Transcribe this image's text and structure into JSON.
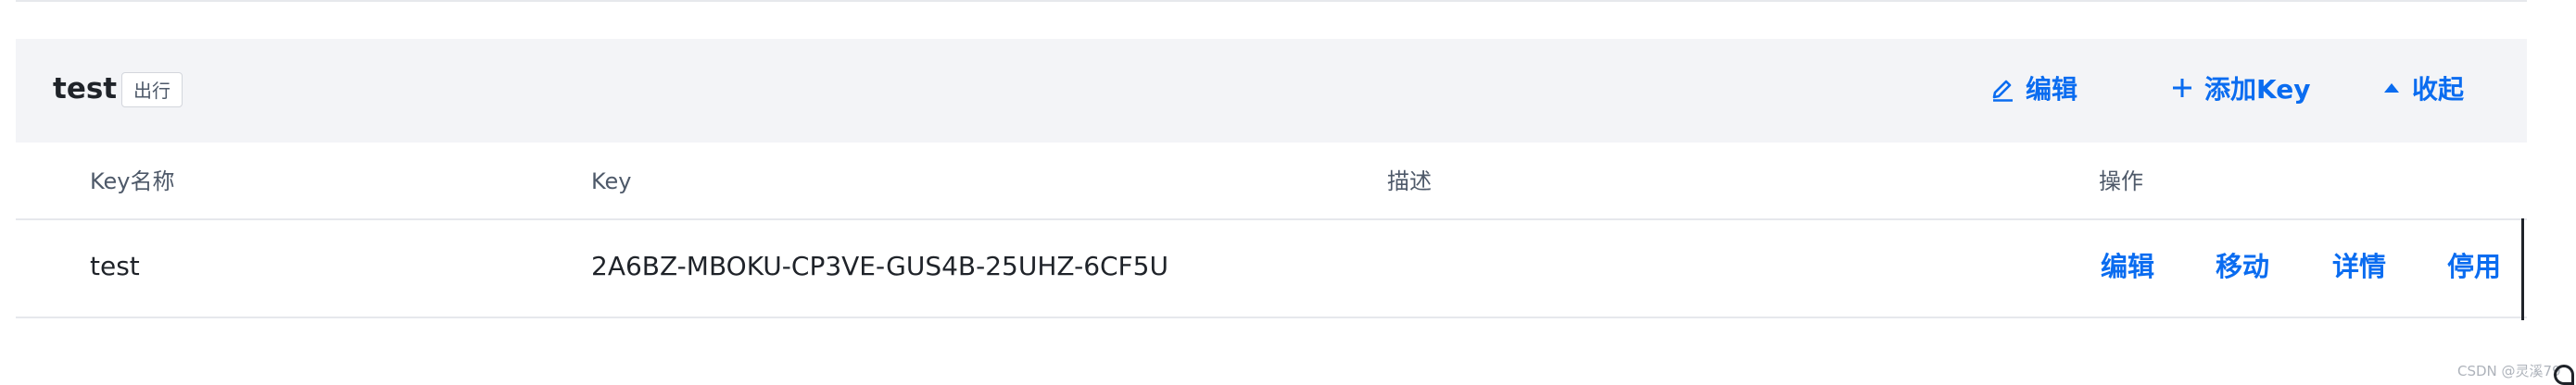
{
  "group": {
    "title": "test",
    "tag": "出行",
    "actions": {
      "edit_label": "编辑",
      "add_key_label": "添加Key",
      "collapse_label": "收起"
    }
  },
  "table": {
    "columns": {
      "key_name": "Key名称",
      "key": "Key",
      "description": "描述",
      "operations": "操作"
    },
    "rows": [
      {
        "key_name": "test",
        "key": "2A6BZ-MBOKU-CP3VE-GUS4B-25UHZ-6CF5U",
        "description": "",
        "ops": {
          "edit": "编辑",
          "move": "移动",
          "detail": "详情",
          "disable": "停用"
        }
      }
    ]
  },
  "watermark": "CSDN @灵溪79",
  "colors": {
    "accent": "#0a6cf0",
    "header_bg": "#f3f4f7",
    "text_primary": "#1f2329",
    "text_secondary": "#4e5969",
    "divider": "#e6e8ec"
  },
  "icons": {
    "edit": "pencil-icon",
    "add": "plus-icon",
    "collapse": "caret-up-icon"
  }
}
